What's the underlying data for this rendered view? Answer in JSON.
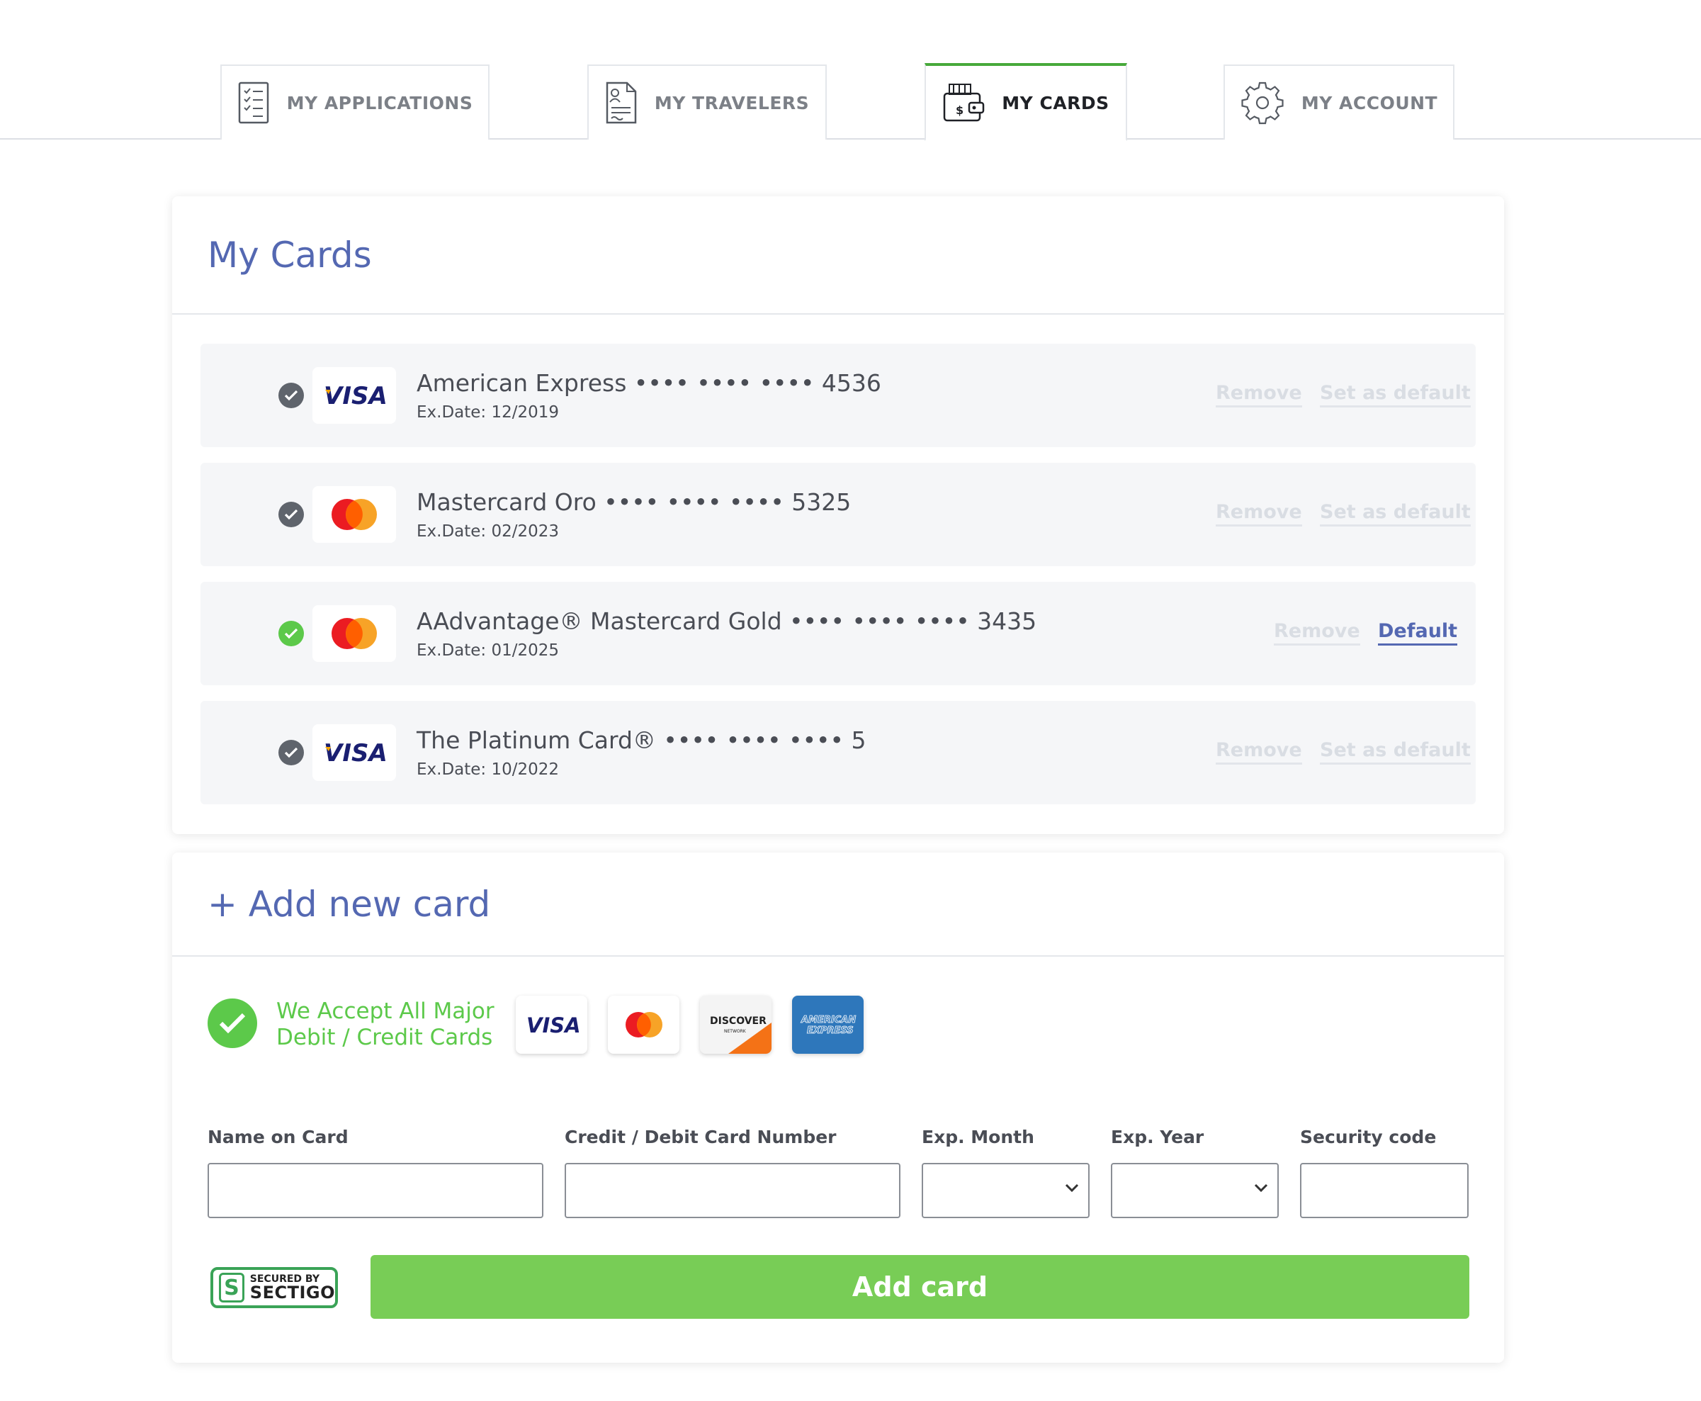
{
  "tabs": [
    {
      "label": "MY APPLICATIONS",
      "icon": "applications-icon"
    },
    {
      "label": "MY TRAVELERS",
      "icon": "travelers-icon"
    },
    {
      "label": "MY CARDS",
      "icon": "wallet-icon",
      "active": true
    },
    {
      "label": "MY ACCOUNT",
      "icon": "gear-icon"
    }
  ],
  "my_cards": {
    "title": "My Cards",
    "cards": [
      {
        "brand": "visa",
        "name": "American Express •••• •••• •••• 4536",
        "exp": "Ex.Date: 12/2019",
        "remove": "Remove",
        "action": "Set as default",
        "is_default": false
      },
      {
        "brand": "mastercard",
        "name": "Mastercard Oro •••• •••• •••• 5325",
        "exp": "Ex.Date: 02/2023",
        "remove": "Remove",
        "action": "Set as default",
        "is_default": false
      },
      {
        "brand": "mastercard",
        "name": "AAdvantage® Mastercard Gold •••• •••• •••• 3435",
        "exp": "Ex.Date: 01/2025",
        "remove": "Remove",
        "action": "Default",
        "is_default": true
      },
      {
        "brand": "visa",
        "name": "The Platinum Card® •••• •••• •••• 5",
        "exp": "Ex.Date: 10/2022",
        "remove": "Remove",
        "action": "Set as default",
        "is_default": false
      }
    ]
  },
  "add_card": {
    "title": "+ Add new card",
    "accept_line1": "We Accept All Major",
    "accept_line2": "Debit / Credit Cards",
    "accepted_logos": [
      "visa",
      "mastercard",
      "discover",
      "american-express"
    ],
    "visa_text": "VISA",
    "discover_text": "DISCOVER",
    "discover_sub": "NETWORK",
    "amex_line1": "AMERICAN",
    "amex_line2": "EXPRESS",
    "fields": {
      "name_label": "Name on Card",
      "number_label": "Credit / Debit Card Number",
      "month_label": "Exp. Month",
      "year_label": "Exp. Year",
      "security_label": "Security code",
      "name_value": "",
      "number_value": "",
      "security_value": ""
    },
    "sectigo_small": "SECURED BY",
    "sectigo_big": "SECTIGO",
    "sectigo_s": "S",
    "button": "Add card"
  },
  "colors": {
    "accent_blue": "#5468b2",
    "accent_green": "#5cc94a",
    "button_green": "#78cd56",
    "active_tab_border": "#47a93a"
  }
}
